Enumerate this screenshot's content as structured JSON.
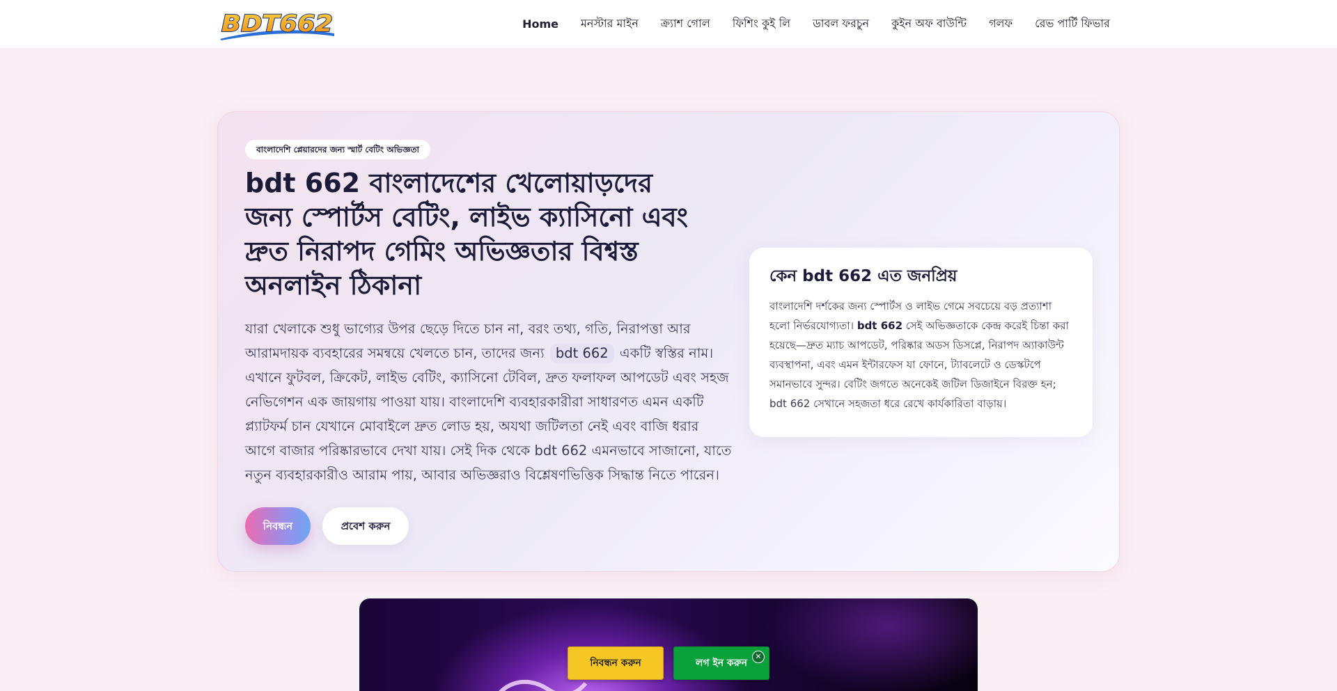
{
  "header": {
    "logo_text": "BDT662",
    "nav": [
      {
        "label": "Home"
      },
      {
        "label": "মনস্টার মাইন"
      },
      {
        "label": "ক্র্যাশ গোল"
      },
      {
        "label": "ফিশিং কুই লি"
      },
      {
        "label": "ডাবল ফরচুন"
      },
      {
        "label": "কুইন অফ বাউন্টি"
      },
      {
        "label": "গলফ"
      },
      {
        "label": "রেভ পার্টি ফিভার"
      }
    ]
  },
  "hero": {
    "badge": "বাংলাদেশি প্লেয়ারদের জন্য স্মার্ট বেটিং অভিজ্ঞতা",
    "title": "bdt 662 বাংলাদেশের খেলোয়াড়দের জন্য স্পোর্টস বেটিং, লাইভ ক্যাসিনো এবং দ্রুত নিরাপদ গেমিং অভিজ্ঞতার বিশ্বস্ত অনলাইন ঠিকানা",
    "text_part1": "যারা খেলাকে শুধু ভাগ্যের উপর ছেড়ে দিতে চান না, বরং তথ্য, গতি, নিরাপত্তা আর আরামদায়ক ব্যবহারের সমন্বয়ে খেলতে চান, তাদের জন্য",
    "text_highlight": "bdt 662",
    "text_part2": "একটি স্বস্তির নাম। এখানে ফুটবল, ক্রিকেট, লাইভ বেটিং, ক্যাসিনো টেবিল, দ্রুত ফলাফল আপডেট এবং সহজ নেভিগেশন এক জায়গায় পাওয়া যায়। বাংলাদেশি ব্যবহারকারীরা সাধারণত এমন একটি প্ল্যাটফর্ম চান যেখানে মোবাইলে দ্রুত লোড হয়, অযথা জটিলতা নেই এবং বাজি ধরার আগে বাজার পরিষ্কারভাবে দেখা যায়। সেই দিক থেকে bdt 662 এমনভাবে সাজানো, যাতে নতুন ব্যবহারকারীও আরাম পায়, আবার অভিজ্ঞরাও বিশ্লেষণভিত্তিক সিদ্ধান্ত নিতে পারেন।",
    "register_label": "নিবন্ধন",
    "login_label": "প্রবেশ করুন"
  },
  "info_card": {
    "title": "কেন bdt 662 এত জনপ্রিয়",
    "text_part1": "বাংলাদেশি দর্শকের জন্য স্পোর্টস ও লাইভ গেমে সবচেয়ে বড় প্রত্যাশা হলো নির্ভরযোগ্যতা।",
    "text_bold": "bdt 662",
    "text_part2": "সেই অভিজ্ঞতাকে কেন্দ্র করেই চিন্তা করা হয়েছে—দ্রুত ম্যাচ আপডেট, পরিষ্কার অডস ডিসপ্লে, নিরাপদ অ্যাকাউন্ট ব্যবস্থাপনা, এবং এমন ইন্টারফেস যা ফোনে, ট্যাবলেটে ও ডেস্কটপে সমানভাবে সুন্দর। বেটিং জগতে অনেকেই জটিল ডিজাইনে বিরক্ত হন; bdt 662 সেখানে সহজতা ধরে রেখে কার্যকারিতা বাড়ায়।"
  },
  "floating_cta": {
    "register_label": "নিবন্ধন করুন",
    "login_label": "লগ ইন করুন",
    "close_symbol": "✕"
  },
  "colors": {
    "accent_pink": "#ec6cb0",
    "accent_blue": "#6fa6f2",
    "cta_yellow": "#f6c624",
    "cta_green": "#0aa13c",
    "page_bg": "#fbeef4"
  }
}
